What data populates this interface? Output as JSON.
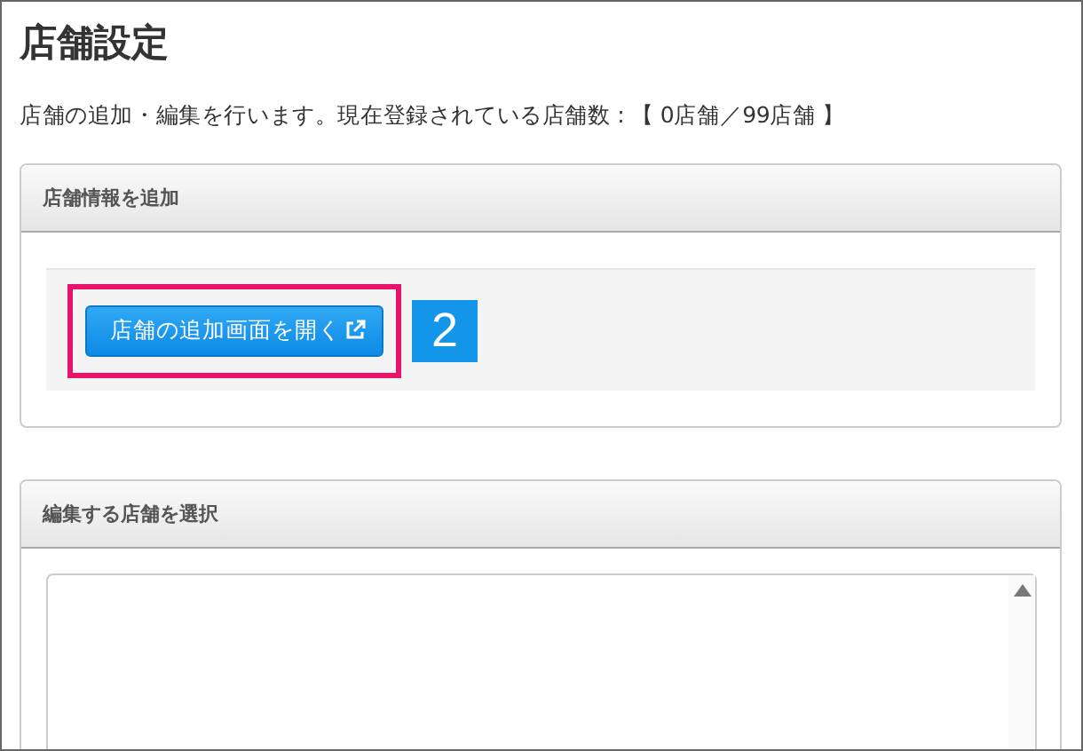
{
  "page": {
    "title": "店舗設定",
    "description": "店舗の追加・編集を行います。現在登録されている店舗数 : 【 0店舗／99店舗 】"
  },
  "panels": [
    {
      "kind": "add",
      "title": "店舗情報を追加",
      "button": {
        "label": "店舗の追加画面を開く",
        "highlighted": true
      },
      "step_badge": "2"
    },
    {
      "kind": "select",
      "title": "編集する店舗を選択"
    }
  ]
}
